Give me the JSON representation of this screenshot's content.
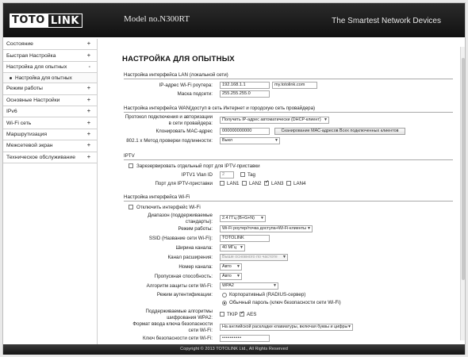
{
  "header": {
    "logo_left": "TOTO",
    "logo_right": "LINK",
    "model": "Model no.N300RT",
    "tagline": "The Smartest Network Devices"
  },
  "sidebar": {
    "items": [
      {
        "label": "Состояние",
        "icon": "+"
      },
      {
        "label": "Быстрая Настройка",
        "icon": "+"
      },
      {
        "label": "Настройка для опытных",
        "icon": "-"
      },
      {
        "label": "Режим работы",
        "icon": "+"
      },
      {
        "label": "Основные Настройки",
        "icon": "+"
      },
      {
        "label": "IPv6",
        "icon": "+"
      },
      {
        "label": "Wi-Fi сеть",
        "icon": "+"
      },
      {
        "label": "Маршрутизация",
        "icon": "+"
      },
      {
        "label": "Межсетевой экран",
        "icon": "+"
      },
      {
        "label": "Техническое обслуживание",
        "icon": "+"
      }
    ],
    "subitem": "Настройка для опытных"
  },
  "main": {
    "title": "НАСТРОЙКА ДЛЯ ОПЫТНЫХ",
    "lan": {
      "heading": "Настройка интерфейса LAN (локальной сети)",
      "ip_label": "IP-адрес Wi-Fi роутера:",
      "ip_value": "192.168.1.1",
      "domain_value": "my.totolink.com",
      "mask_label": "Маска подсети:",
      "mask_value": "255.255.255.0"
    },
    "wan": {
      "heading": "Настройка интерфейса WAN(доступ в сеть Интернет и городскую сеть провайдера)",
      "protocol_label": "Протокол подключения и авторизации в сети провайдера:",
      "protocol_value": "Получить IP-адрес автоматически (DHCP-клиент)",
      "mac_label": "Клонировать МАС-адрес",
      "mac_value": "000000000000",
      "mac_button": "Сканирование МАС-адресов Всех подключенных клиентов",
      "dot1x_label": "802.1 x Метод проверки подлинности:",
      "dot1x_value": "Выкл"
    },
    "iptv": {
      "heading": "IPTV",
      "reserve_label": "Зарезервировать отдельный порт для IPTV-приставки",
      "vlan_label": "IPTV1 Vlan ID",
      "vlan_value": "2",
      "tag_label": "Tag",
      "port_label": "Порт для IPTV-приставки",
      "ports": [
        {
          "label": "LAN1",
          "checked": false
        },
        {
          "label": "LAN2",
          "checked": false
        },
        {
          "label": "LAN3",
          "checked": true
        },
        {
          "label": "LAN4",
          "checked": false
        }
      ]
    },
    "wifi": {
      "heading": "Настройка интерфейса Wi-Fi",
      "disable_label": "Отключить интерфейс Wi-Fi",
      "band_label": "Диапазон (поддерживаемые стандарты):",
      "band_value": "2.4 ГГц (B+G+N)",
      "mode_label": "Режим работы:",
      "mode_value": "Wi-Fi роутер/точка доступа+Wi-Fi-клиенты",
      "ssid_label": "SSID (Название сети Wi-Fi):",
      "ssid_value": "TOTOLINK",
      "width_label": "Ширина канала:",
      "width_value": "40 МГц",
      "ext_label": "Канал расширения:",
      "ext_value": "Выше основного по частоте",
      "channel_label": "Номер канала:",
      "channel_value": "Авто",
      "speed_label": "Пропускная способность:",
      "speed_value": "Авто",
      "security_label": "Алгоритм защиты сети Wi-Fi:",
      "security_value": "WPA2",
      "auth_label": "Режим аутентификации:",
      "auth_opt1": "Корпоративный (RADIUS-сервер)",
      "auth_opt2": "Обычный пароль (ключ безопасности сети Wi-Fi)",
      "cipher_label": "Поддерживаемые алгоритмы шифрования WPA2:",
      "cipher_tkip": "TKIP",
      "cipher_aes": "AES",
      "format_label": "Формат ввода ключа безопасности сети Wi-Fi:",
      "format_value": "На английской раскладке клавиатуры, включая буквы и цифры",
      "key_label": "Ключ безопасности сети Wi-Fi:",
      "key_value": "••••••••••"
    }
  },
  "footer": {
    "copyright": "Copyright © 2013 TOTOLINK Ltd.,   All Rights Reserved"
  }
}
